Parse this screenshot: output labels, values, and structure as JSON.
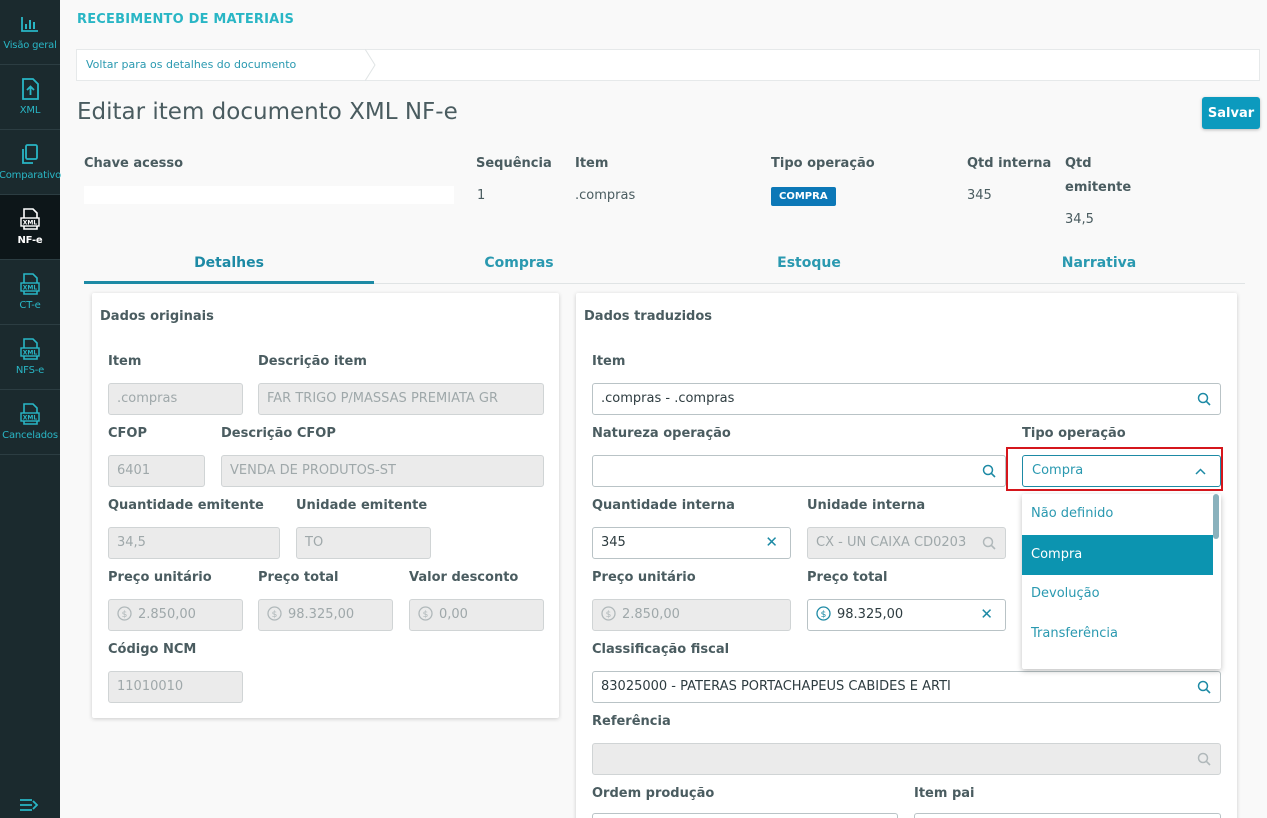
{
  "sidebar": {
    "items": [
      {
        "label": "Visão geral",
        "icon": "chart-icon"
      },
      {
        "label": "XML",
        "icon": "upload-file-icon"
      },
      {
        "label": "Comparativo",
        "icon": "copy-icon"
      },
      {
        "label": "NF-e",
        "icon": "xml-file-icon",
        "active": true
      },
      {
        "label": "CT-e",
        "icon": "xml-file-icon"
      },
      {
        "label": "NFS-e",
        "icon": "xml-file-icon"
      },
      {
        "label": "Cancelados",
        "icon": "xml-file-icon"
      }
    ],
    "xml_badge": "XML",
    "collapse_icon": "menu-collapse-icon"
  },
  "header": {
    "app_title": "RECEBIMENTO DE MATERIAIS",
    "breadcrumb": "Voltar para os detalhes do documento",
    "page_title": "Editar item documento XML NF-e",
    "save_label": "Salvar"
  },
  "summary": {
    "chave_label": "Chave acesso",
    "sequencia_label": "Sequência",
    "sequencia_value": "1",
    "item_label": "Item",
    "item_value": ".compras",
    "tipo_label": "Tipo operação",
    "tipo_value": "COMPRA",
    "qtd_interna_label": "Qtd interna",
    "qtd_interna_value": "345",
    "qtd_emitente_label_1": "Qtd",
    "qtd_emitente_label_2": "emitente",
    "qtd_emitente_value": "34,5"
  },
  "tabs": [
    "Detalhes",
    "Compras",
    "Estoque",
    "Narrativa"
  ],
  "original": {
    "title": "Dados originais",
    "item_label": "Item",
    "item_value": ".compras",
    "descricao_label": "Descrição item",
    "descricao_value": "FAR TRIGO P/MASSAS PREMIATA GR",
    "cfop_label": "CFOP",
    "cfop_value": "6401",
    "desc_cfop_label": "Descrição CFOP",
    "desc_cfop_value": "VENDA DE PRODUTOS-ST",
    "qtd_emitente_label": "Quantidade emitente",
    "qtd_emitente_value": "34,5",
    "unidade_emitente_label": "Unidade emitente",
    "unidade_emitente_value": "TO",
    "preco_unitario_label": "Preço unitário",
    "preco_unitario_value": "2.850,00",
    "preco_total_label": "Preço total",
    "preco_total_value": "98.325,00",
    "valor_desconto_label": "Valor desconto",
    "valor_desconto_value": "0,00",
    "ncm_label": "Código NCM",
    "ncm_value": "11010010"
  },
  "translated": {
    "title": "Dados traduzidos",
    "item_label": "Item",
    "item_value": ".compras - .compras",
    "natureza_label": "Natureza operação",
    "natureza_value": "",
    "tipo_label": "Tipo operação",
    "tipo_value": "Compra",
    "qtd_interna_label": "Quantidade interna",
    "qtd_interna_value": "345",
    "unidade_interna_label": "Unidade interna",
    "unidade_interna_value": "CX - UN CAIXA CD0203",
    "preco_unitario_label": "Preço unitário",
    "preco_unitario_value": "2.850,00",
    "preco_total_label": "Preço total",
    "preco_total_value": "98.325,00",
    "classificacao_label": "Classificação fiscal",
    "classificacao_value": "83025000 - PATERAS PORTACHAPEUS CABIDES E ARTI",
    "referencia_label": "Referência",
    "referencia_value": "",
    "ordem_label": "Ordem produção",
    "item_pai_label": "Item pai",
    "clear_symbol": "✕"
  },
  "dropdown": {
    "options": [
      "Não definido",
      "Compra",
      "Devolução",
      "Transferência"
    ],
    "selected": "Compra"
  },
  "colors": {
    "accent": "#0c9abe",
    "sidebar_bg": "#1b2a2e",
    "highlight": "#d5161c",
    "tag": "#0c78b7"
  }
}
